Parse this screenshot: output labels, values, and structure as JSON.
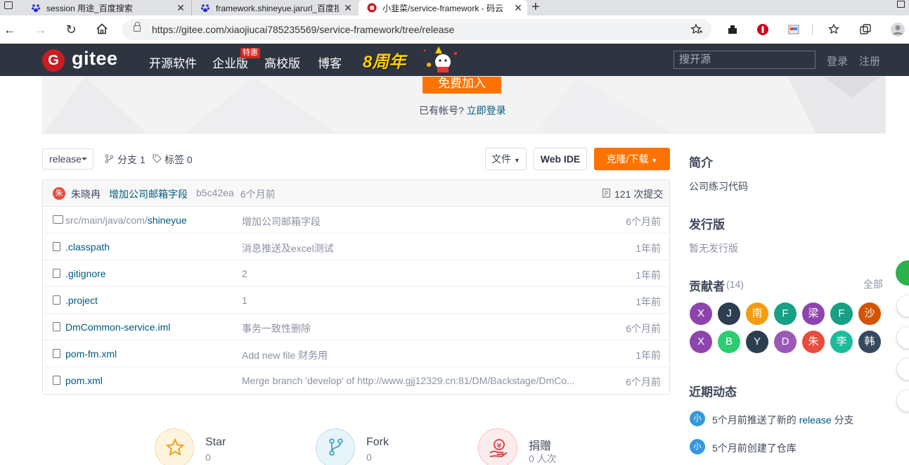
{
  "browser": {
    "tabs": [
      {
        "title": "session 用途_百度搜索",
        "icon": "baidu-paw-icon"
      },
      {
        "title": "framework.shineyue.jarurl_百度搜",
        "icon": "baidu-paw-icon"
      },
      {
        "title": "小韭菜/service-framework - 码云",
        "icon": "gitee-icon",
        "active": true
      }
    ],
    "url": "https://gitee.com/xiaojiucai785235569/service-framework/tree/release"
  },
  "header": {
    "logo_mark": "G",
    "logo_text": "gitee",
    "nav": [
      "开源软件",
      "企业版",
      "高校版",
      "博客"
    ],
    "hot_badge": "特惠",
    "anniversary": "8周年",
    "search_placeholder": "搜开源",
    "login": "登录",
    "register": "注册"
  },
  "banner": {
    "join_button": "免费加入",
    "have_account": "已有帐号?",
    "login_link": "立即登录"
  },
  "repo": {
    "branch": "release",
    "branches": "分支 1",
    "tags": "标签 0",
    "file_button": "文件",
    "webide_button": "Web IDE",
    "clone_button": "克隆/下载"
  },
  "commit": {
    "avatar": "朱",
    "author": "朱晓冉",
    "message": "增加公司邮箱字段",
    "hash": "b5c42ea",
    "time": "6个月前",
    "count": "121 次提交"
  },
  "files": [
    {
      "type": "dir",
      "prefix": "src/main/java/com/",
      "name": "shineyue",
      "message": "增加公司邮箱字段",
      "time": "6个月前"
    },
    {
      "type": "file",
      "prefix": "",
      "name": ".classpath",
      "message": "消息推送及excel测试",
      "time": "1年前"
    },
    {
      "type": "file",
      "prefix": "",
      "name": ".gitignore",
      "message": "2",
      "time": "1年前"
    },
    {
      "type": "file",
      "prefix": "",
      "name": ".project",
      "message": "1",
      "time": "1年前"
    },
    {
      "type": "file",
      "prefix": "",
      "name": "DmCommon-service.iml",
      "message": "事务一致性删除",
      "time": "6个月前"
    },
    {
      "type": "file",
      "prefix": "",
      "name": "pom-fm.xml",
      "message": "Add new file 财务用",
      "time": "1年前"
    },
    {
      "type": "file",
      "prefix": "",
      "name": "pom.xml",
      "message": "Merge branch 'develop' of http://www.gjj12329.cn:81/DM/Backstage/DmCo...",
      "time": "6个月前"
    }
  ],
  "stats": [
    {
      "label": "Star",
      "value": "0",
      "icon": "star-icon",
      "color": "#f3a117"
    },
    {
      "label": "Fork",
      "value": "0",
      "icon": "fork-icon",
      "color": "#4aa9c7"
    },
    {
      "label": "捐赠",
      "value": "0 人次",
      "icon": "donate-icon",
      "color": "#d94a4a"
    }
  ],
  "sidebar": {
    "intro_title": "简介",
    "intro_text": "公司练习代码",
    "release_title": "发行版",
    "release_text": "暂无发行版",
    "contrib_title": "贡献者",
    "contrib_count": "(14)",
    "contrib_all": "全部",
    "contributors": [
      {
        "letter": "X",
        "color": "#8e44ad"
      },
      {
        "letter": "J",
        "color": "#2c3e50"
      },
      {
        "letter": "南",
        "color": "#f39c12"
      },
      {
        "letter": "F",
        "color": "#16a085"
      },
      {
        "letter": "梁",
        "color": "#8e44ad"
      },
      {
        "letter": "F",
        "color": "#16a085"
      },
      {
        "letter": "沙",
        "color": "#d35400"
      },
      {
        "letter": "X",
        "color": "#8e44ad"
      },
      {
        "letter": "B",
        "color": "#2ecc71"
      },
      {
        "letter": "Y",
        "color": "#2c3e50"
      },
      {
        "letter": "D",
        "color": "#9b59b6"
      },
      {
        "letter": "朱",
        "color": "#e74c3c"
      },
      {
        "letter": "李",
        "color": "#1abc9c"
      },
      {
        "letter": "韩",
        "color": "#34495e"
      }
    ],
    "activity_title": "近期动态",
    "activity": [
      {
        "avatar": "小",
        "pre": "5个月前推送了新的",
        "link": "release",
        "post": "分支"
      },
      {
        "avatar": "小",
        "pre": "5个月前创建了仓库",
        "link": "",
        "post": ""
      }
    ]
  }
}
